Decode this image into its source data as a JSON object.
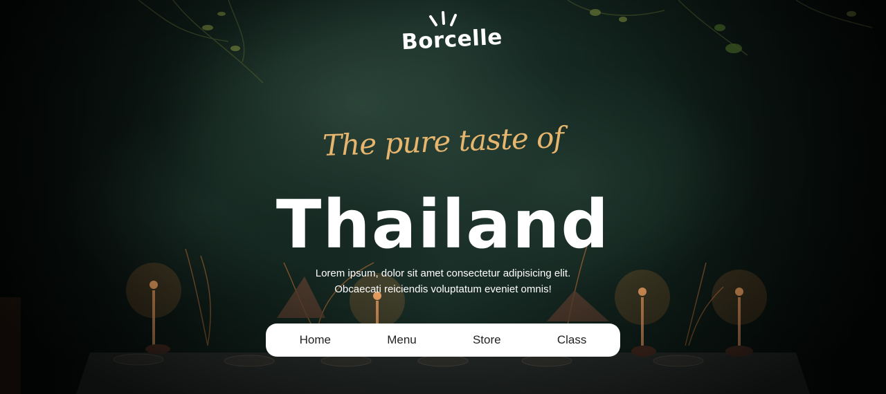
{
  "brand": {
    "logo_text": "Borcelle"
  },
  "hero": {
    "tagline": "The pure taste of",
    "headline": "Thailand",
    "description_line1": "Lorem ipsum, dolor sit amet consectetur adipisicing elit.",
    "description_line2": "Obcaecati reiciendis voluptatum eveniet omnis!"
  },
  "nav": {
    "items": [
      {
        "label": "Home"
      },
      {
        "label": "Menu"
      },
      {
        "label": "Store"
      },
      {
        "label": "Class"
      }
    ]
  },
  "colors": {
    "tagline_accent": "#e6b56e",
    "headline": "#ffffff",
    "nav_background": "#ffffff",
    "nav_text": "#222222",
    "background_dark_green": "#10201a"
  },
  "icons": {
    "logo_mark": "sun-rays-icon"
  }
}
